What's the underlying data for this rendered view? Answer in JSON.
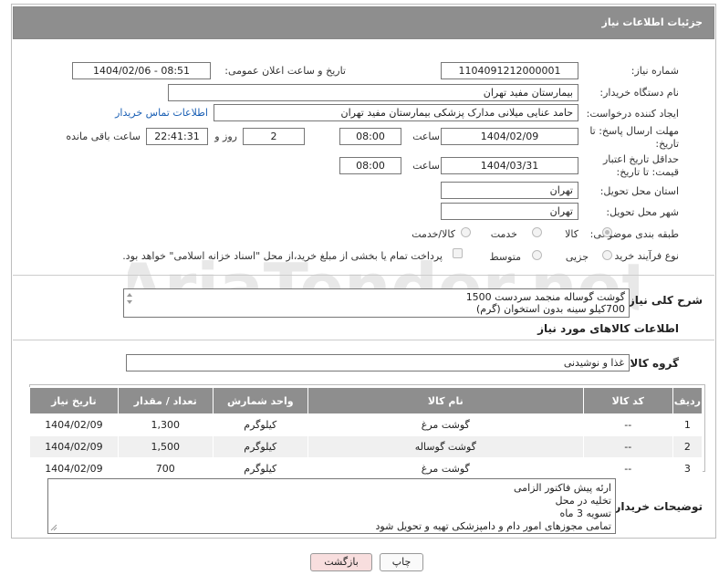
{
  "header": {
    "title": "جزئیات اطلاعات نیاز"
  },
  "labels": {
    "need_number": "شماره نیاز:",
    "announce_datetime": "تاریخ و ساعت اعلان عمومی:",
    "buyer_org": "نام دستگاه خریدار:",
    "creator": "ایجاد کننده درخواست:",
    "contact_link": "اطلاعات تماس خریدار",
    "reply_deadline": "مهلت ارسال پاسخ: تا تاریخ:",
    "time_word": "ساعت",
    "day_and": "روز و",
    "time_remaining": "ساعت باقی مانده",
    "min_price_valid": "حداقل تاریخ اعتبار قیمت: تا تاریخ:",
    "delivery_province": "استان محل تحویل:",
    "delivery_city": "شهر محل تحویل:",
    "category": "طبقه بندی موضوعی:",
    "purchase_type": "نوع فرآیند خرید :",
    "description": "شرح کلی نیاز:",
    "goods_info": "اطلاعات کالاهای مورد نیاز",
    "goods_group": "گروه کالا:",
    "buyer_notes": "توضیحات خریدار:"
  },
  "values": {
    "need_number": "1104091212000001",
    "announce_datetime": "1404/02/06 - 08:51",
    "buyer_org": "بیمارستان مفید تهران",
    "creator": "حامد عنایی میلانی مدارک پزشکی بیمارستان مفید تهران",
    "reply_date": "1404/02/09",
    "reply_time": "08:00",
    "days": "2",
    "remaining": "22:41:31",
    "price_valid_date": "1404/03/31",
    "price_valid_time": "08:00",
    "province": "تهران",
    "city": "تهران",
    "goods_group": "غذا و نوشیدنی"
  },
  "category_options": [
    {
      "label": "کالا",
      "selected": true
    },
    {
      "label": "خدمت",
      "selected": false
    },
    {
      "label": "کالا/خدمت",
      "selected": false
    }
  ],
  "purchase_options": [
    {
      "label": "جزیی",
      "selected": false
    },
    {
      "label": "متوسط",
      "selected": false
    }
  ],
  "payment_note": "پرداخت تمام یا بخشی از مبلغ خرید،از محل \"اسناد خزانه اسلامی\" خواهد بود.",
  "description_lines": [
    "گوشت گوساله منجمد سردست 1500",
    "700کیلو سینه بدون استخوان (گرم)"
  ],
  "table": {
    "headers": [
      "ردیف",
      "کد کالا",
      "نام کالا",
      "واحد شمارش",
      "تعداد / مقدار",
      "تاریخ نیاز"
    ],
    "rows": [
      [
        "1",
        "--",
        "گوشت مرغ",
        "کیلوگرم",
        "1,300",
        "1404/02/09"
      ],
      [
        "2",
        "--",
        "گوشت گوساله",
        "کیلوگرم",
        "1,500",
        "1404/02/09"
      ],
      [
        "3",
        "--",
        "گوشت مرغ",
        "کیلوگرم",
        "700",
        "1404/02/09"
      ]
    ]
  },
  "notes_lines": [
    "ارئه پیش فاکتور الزامی",
    "تخلیه در محل",
    "تسویه 3 ماه",
    "تمامی مجوزهای امور دام و دامپزشکی تهیه و تحویل شود"
  ],
  "buttons": {
    "print": "چاپ",
    "back": "بازگشت"
  },
  "watermark": "AriaTender.net",
  "colors": {
    "header_bg": "#8e8e8e",
    "back_btn_bg": "#f8dede",
    "link": "#1a5fb4"
  }
}
